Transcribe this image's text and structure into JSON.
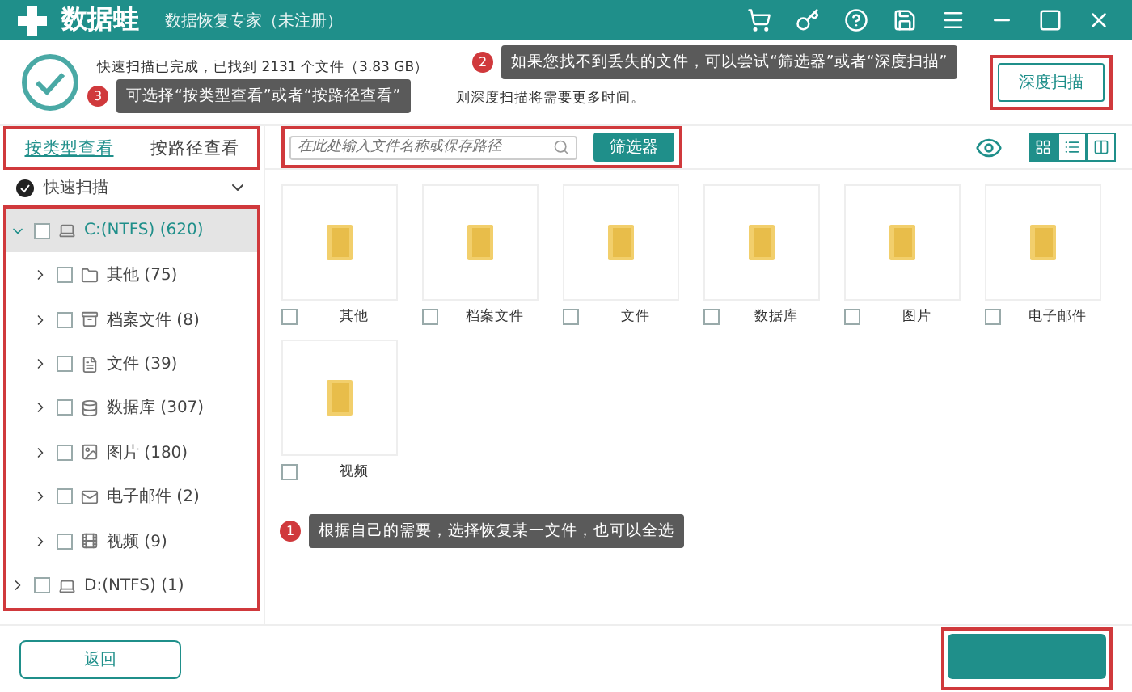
{
  "window": {
    "app_name": "数据蛙",
    "title": "数据恢复专家（未注册）"
  },
  "scan_status": {
    "summary": "快速扫描已完成，已找到 2131 个文件（3.83 GB）",
    "note": "则深度扫描将需要更多时间。"
  },
  "deep_scan_button": "深度扫描",
  "view_tabs": [
    {
      "label": "按类型查看",
      "selected": true
    },
    {
      "label": "按路径查看",
      "selected": false
    }
  ],
  "scan_mode": {
    "label": "快速扫描",
    "expanded": true
  },
  "tree": [
    {
      "label": "C:(NTFS) (620)",
      "kind": "drive",
      "selected": true,
      "expanded": true,
      "checked": false,
      "children": [
        {
          "label": "其他 (75)",
          "kind": "folder",
          "selected": false,
          "expanded": false,
          "checked": false
        },
        {
          "label": "档案文件 (8)",
          "kind": "archive",
          "selected": false,
          "expanded": false,
          "checked": false
        },
        {
          "label": "文件 (39)",
          "kind": "document",
          "selected": false,
          "expanded": false,
          "checked": false
        },
        {
          "label": "数据库 (307)",
          "kind": "database",
          "selected": false,
          "expanded": false,
          "checked": false
        },
        {
          "label": "图片 (180)",
          "kind": "image",
          "selected": false,
          "expanded": false,
          "checked": false
        },
        {
          "label": "电子邮件 (2)",
          "kind": "email",
          "selected": false,
          "expanded": false,
          "checked": false
        },
        {
          "label": "视频 (9)",
          "kind": "video",
          "selected": false,
          "expanded": false,
          "checked": false
        }
      ]
    },
    {
      "label": "D:(NTFS) (1)",
      "kind": "drive",
      "selected": false,
      "expanded": false,
      "checked": false
    }
  ],
  "search": {
    "placeholder": "在此处输入文件名称或保存路径"
  },
  "filter_button": "筛选器",
  "view_modes": [
    {
      "kind": "grid",
      "selected": true
    },
    {
      "kind": "list",
      "selected": false
    },
    {
      "kind": "columns",
      "selected": false
    }
  ],
  "files": [
    {
      "name": "其他",
      "checked": false
    },
    {
      "name": "档案文件",
      "checked": false
    },
    {
      "name": "文件",
      "checked": false
    },
    {
      "name": "数据库",
      "checked": false
    },
    {
      "name": "图片",
      "checked": false
    },
    {
      "name": "电子邮件",
      "checked": false
    },
    {
      "name": "视频",
      "checked": false
    }
  ],
  "annotations": [
    {
      "number": "1",
      "text": "根据自己的需要，选择恢复某一文件，也可以全选"
    },
    {
      "number": "2",
      "text": "如果您找不到丢失的文件，可以尝试“筛选器”或者“深度扫描”"
    },
    {
      "number": "3",
      "text": "可选择“按类型查看”或者“按路径查看”"
    }
  ],
  "back_button": "返回"
}
